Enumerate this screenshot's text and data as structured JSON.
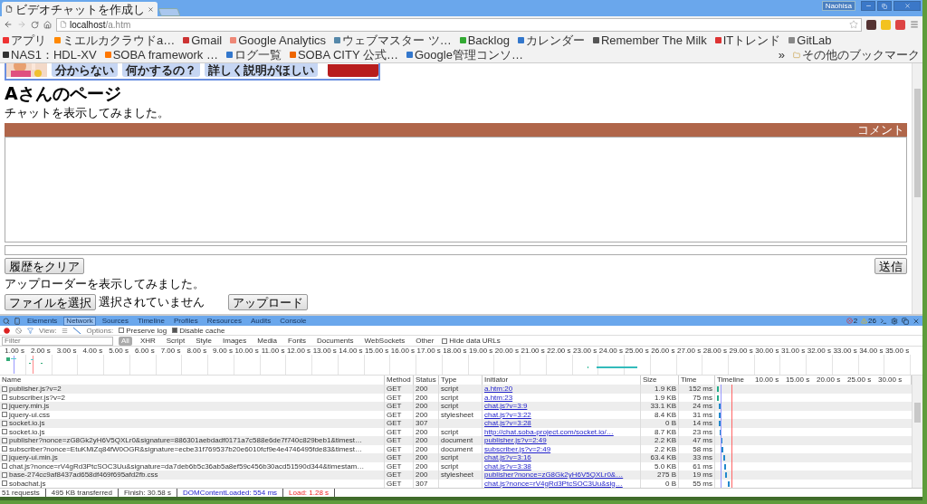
{
  "window": {
    "tab_title": "ビデオチャットを作成し",
    "user": "Naohisa"
  },
  "address_bar": {
    "host": "localhost",
    "path": "/a.htm"
  },
  "bookmarks": [
    {
      "label": "アプリ"
    },
    {
      "label": "ミエルカクラウドa…"
    },
    {
      "label": "Gmail"
    },
    {
      "label": "Google Analytics"
    },
    {
      "label": "ウェブマスター ツ…"
    },
    {
      "label": "Backlog"
    },
    {
      "label": "カレンダー"
    },
    {
      "label": "Remember The Milk"
    },
    {
      "label": "ITトレンド"
    },
    {
      "label": "GitLab"
    },
    {
      "label": "NAS1：HDL-XV"
    },
    {
      "label": "SOBA framework …"
    },
    {
      "label": "ログ一覧"
    },
    {
      "label": "SOBA CITY 公式…"
    },
    {
      "label": "Google管理コンソ…"
    }
  ],
  "bookmarks_more": "»",
  "other_bookmarks": "その他のブックマーク",
  "banner": {
    "bubbles": [
      "分からない",
      "何かするの？",
      "詳しく説明がほしい"
    ]
  },
  "page": {
    "heading": "Aさんのページ",
    "chat_intro": "チャットを表示してみました。",
    "comment_label": "コメント",
    "clear_button": "履歴をクリア",
    "send_button": "送信",
    "uploader_intro": "アップローダーを表示してみました。",
    "file_button": "ファイルを選択",
    "file_status": "選択されていません",
    "upload_button": "アップロード"
  },
  "devtools": {
    "tabs": [
      {
        "label": "Elements",
        "selected": false
      },
      {
        "label": "Network",
        "selected": true
      },
      {
        "label": "Sources",
        "selected": false
      },
      {
        "label": "Timeline",
        "selected": false
      },
      {
        "label": "Profiles",
        "selected": false
      },
      {
        "label": "Resources",
        "selected": false
      },
      {
        "label": "Audits",
        "selected": false
      },
      {
        "label": "Console",
        "selected": false
      }
    ],
    "errors": "2",
    "warnings": "26",
    "view_label": "View:",
    "options_label": "Options:",
    "preserve_log": {
      "label": "Preserve log",
      "checked": false
    },
    "disable_cache": {
      "label": "Disable cache",
      "checked": true
    },
    "filter_placeholder": "Filter",
    "type_filters": [
      {
        "label": "All",
        "selected": true
      },
      {
        "label": "XHR",
        "selected": false
      },
      {
        "label": "Script",
        "selected": false
      },
      {
        "label": "Style",
        "selected": false
      },
      {
        "label": "Images",
        "selected": false
      },
      {
        "label": "Media",
        "selected": false
      },
      {
        "label": "Fonts",
        "selected": false
      },
      {
        "label": "Documents",
        "selected": false
      },
      {
        "label": "WebSockets",
        "selected": false
      },
      {
        "label": "Other",
        "selected": false
      }
    ],
    "hide_data_urls": {
      "label": "Hide data URLs",
      "checked": false
    },
    "overview_ticks": [
      "1.00 s",
      "2.00 s",
      "3.00 s",
      "4.00 s",
      "5.00 s",
      "6.00 s",
      "7.00 s",
      "8.00 s",
      "9.00 s",
      "10.00 s",
      "11.00 s",
      "12.00 s",
      "13.00 s",
      "14.00 s",
      "15.00 s",
      "16.00 s",
      "17.00 s",
      "18.00 s",
      "19.00 s",
      "20.00 s",
      "21.00 s",
      "22.00 s",
      "23.00 s",
      "24.00 s",
      "25.00 s",
      "26.00 s",
      "27.00 s",
      "28.00 s",
      "29.00 s",
      "30.00 s",
      "31.00 s",
      "32.00 s",
      "33.00 s",
      "34.00 s",
      "35.00 s"
    ],
    "columns": [
      "Name",
      "Method",
      "Status",
      "Type",
      "Initiator",
      "Size",
      "Time",
      "Timeline"
    ],
    "timeline_ticks": [
      "10.00 s",
      "15.00 s",
      "20.00 s",
      "25.00 s",
      "30.00 s"
    ],
    "rows": [
      {
        "name": "publisher.js?v=2",
        "method": "GET",
        "status": "200",
        "type": "script",
        "initiator": "a.htm:20",
        "size": "1.9 KB",
        "time": "152 ms"
      },
      {
        "name": "subscriber.js?v=2",
        "method": "GET",
        "status": "200",
        "type": "script",
        "initiator": "a.htm:23",
        "size": "1.9 KB",
        "time": "75 ms"
      },
      {
        "name": "jquery.min.js",
        "method": "GET",
        "status": "200",
        "type": "script",
        "initiator": "chat.js?v=3:9",
        "size": "33.1 KB",
        "time": "24 ms"
      },
      {
        "name": "jquery-ui.css",
        "method": "GET",
        "status": "200",
        "type": "stylesheet",
        "initiator": "chat.js?v=3:22",
        "size": "8.4 KB",
        "time": "31 ms"
      },
      {
        "name": "socket.io.js",
        "method": "GET",
        "status": "307",
        "initiator": "chat.js?v=3:28",
        "size": "0 B",
        "time": "14 ms"
      },
      {
        "name": "socket.io.js",
        "method": "GET",
        "status": "200",
        "type": "script",
        "initiator": "http://chat.soba-project.com/socket.io/…",
        "size": "8.7 KB",
        "time": "23 ms"
      },
      {
        "name": "publisher?nonce=zG8Gk2yH6V5QXLr0&signature=886301aebdadf0171a7c588e6de7f740c829beb1&timest…",
        "method": "GET",
        "status": "200",
        "type": "document",
        "initiator": "publisher.js?v=2:49",
        "size": "2.2 KB",
        "time": "47 ms"
      },
      {
        "name": "subscriber?nonce=EtuKMiZq84fW0OGR&signature=ecbe31f769537b20e6010fcf9e4e4746495fde83&timest…",
        "method": "GET",
        "status": "200",
        "type": "document",
        "initiator": "subscriber.js?v=2:49",
        "size": "2.2 KB",
        "time": "58 ms"
      },
      {
        "name": "jquery-ui.min.js",
        "method": "GET",
        "status": "200",
        "type": "script",
        "initiator": "chat.js?v=3:16",
        "size": "63.4 KB",
        "time": "33 ms"
      },
      {
        "name": "chat.js?nonce=rV4gRd3PtcSOC3Uu&signature=da7deb6b5c36ab5a8ef59c456b30acd51590d344&timestam…",
        "method": "GET",
        "status": "200",
        "type": "script",
        "initiator": "chat.js?v=3:38",
        "size": "5.0 KB",
        "time": "61 ms"
      },
      {
        "name": "base-274cc9af8437ad658df469f695afd2fb.css",
        "method": "GET",
        "status": "200",
        "type": "stylesheet",
        "initiator": "publisher?nonce=zG8Gk2yH6V5QXLr0&…",
        "size": "275 B",
        "time": "19 ms"
      },
      {
        "name": "sobachat.js",
        "method": "GET",
        "status": "307",
        "initiator": "chat.js?nonce=rV4gRd3PtcSOC3Uu&sig…",
        "size": "0 B",
        "time": "55 ms"
      }
    ],
    "summary": {
      "requests": "51 requests",
      "transferred": "495 KB transferred",
      "finish": "Finish: 30.58 s",
      "dom_loaded": "DOMContentLoaded: 554 ms",
      "load": "Load: 1.28 s"
    }
  }
}
